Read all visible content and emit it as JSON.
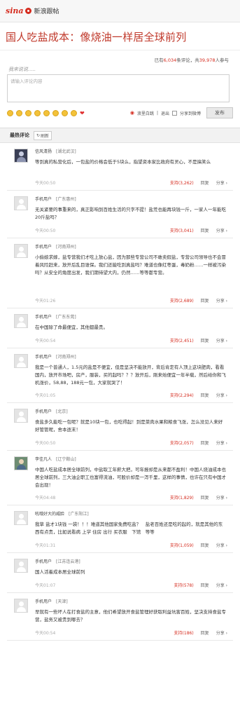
{
  "brand": {
    "logo_word": "sina",
    "product": "新浪跟帖"
  },
  "headline": "国人吃盐成本：像烧油一样居全球前列",
  "stats": {
    "prefix": "已有",
    "comments": "6,034",
    "middle": "条评论，共",
    "participants": "39,978",
    "suffix": "人参与"
  },
  "compose": {
    "heading": "我来说说.....",
    "placeholder": "请输入评论内容",
    "weibo_label": "浪里白跳",
    "logout": "退出",
    "share_label": "分享到微博",
    "submit": "发布"
  },
  "section": {
    "title": "最热评论",
    "refresh": "刷新"
  },
  "comments": [
    {
      "user": "信风清扬",
      "location": "[湖北武汉]",
      "avatar": "dark",
      "text": "等到真的私营化后，一包盐的价格会低于5块么，指望资本家比政府有灵心，不是搞笑么",
      "time": "今天00:50",
      "support": "支持(3,262)",
      "reply": "回复",
      "share": "分享 ›"
    },
    {
      "user": "手机用户",
      "location": "[广东惠州]",
      "avatar": "default",
      "text": "无关紧要的事重来的，真正影响到百姓生活的只字不提！盐荒也能再块钱一斤，一家人一年能吃20斤盐吗？",
      "time": "今天00:50",
      "support": "支持(3,041)",
      "reply": "回复",
      "share": "分享 ›"
    },
    {
      "user": "手机用户",
      "location": "[河南郑州]",
      "avatar": "default",
      "text": "小偷娘求嫁，盐专营我们才吃上放心盐，因为那些专营公司不敢卖假盐，专营公司领导也不会冒着风险赶来，放开后乱目谁保。我们还能吃到真盐吗？难道也像红枣蛋，毒奶粉……一样被污染吗？从安全的角度出发，我们期待望大内，仍然……等等都专营。",
      "time": "今天01:26",
      "support": "支持(2,689)",
      "reply": "回复",
      "share": "分享 ›"
    },
    {
      "user": "手机用户",
      "location": "[广东东莞]",
      "avatar": "default",
      "text": "在中国除了命最便宜，其他都最贵。",
      "time": "今天00:54",
      "support": "支持(2,451)",
      "reply": "回复",
      "share": "分享 ›"
    },
    {
      "user": "手机用户",
      "location": "[河南郑州]",
      "avatar": "default",
      "text": "我是一个普通人，1.5元的盐是不便宜，但是坚决不能放开，背后肯定有人顶上这块肥肉，看看国内，放开市场吧，房产，服装，买的起吗？？？放开后，刚来始便宜一年半载，然后给你和飞机涨价，58,88，188元一包，大家就哭了！",
      "time": "今天01:05",
      "support": "支持(2,294)",
      "reply": "回复",
      "share": "分享 ›"
    },
    {
      "user": "手机用户",
      "location": "[北京]",
      "avatar": "default",
      "text": "食盐多久能吃一包呢？就是10块一包，也吃得起！到是菜肉水果和粮食飞涨，怎么没见人来好好管管呢，舍本逐末！",
      "time": "今天00:50",
      "support": "支持(2,057)",
      "reply": "回复",
      "share": "分享 ›"
    },
    {
      "user": "李佳凡人",
      "location": "[辽宁鞍山]",
      "avatar": "photo",
      "text": "中国人吃盐成本居全球前列，中盐取工年薪大把，可年报却是从来都不盈利！中国人烧油成本也居全球前列，三大油企职工也富得流油，可股价却是一泻千里，这样的事情，也许在只有中国才会出现！",
      "time": "今天04:48",
      "support": "支持(1,829)",
      "reply": "回复",
      "share": "分享 ›"
    },
    {
      "user": "吼哦好大的威脸",
      "location": "[广东阳江]",
      "avatar": "default",
      "text": "我草 盐才1块钱 一袋！！！难道其他国家免费吃盐？　盐老百姓还是吃的起的，就是其他的东西有点贵，比如说看病 上学 住房 出行 买衣服　下馆　等等",
      "time": "今天01:31",
      "support": "支持(1,059)",
      "reply": "回复",
      "share": "分享 ›"
    },
    {
      "user": "手机用户",
      "location": "[江苏连云港]",
      "avatar": "default",
      "text": "国人活着成本居全球前列",
      "time": "今天01:07",
      "support": "支持(578)",
      "reply": "回复",
      "share": "分享 ›"
    },
    {
      "user": "手机用户",
      "location": "[天津]",
      "avatar": "default",
      "text": "早就有一些坏人在打食盐的主意，他们希望放开食盐管理好获取利益坑害百姓，坚决支持食盐专营，盐务又被贵到哪去？",
      "time": "今天00:54",
      "support": "支持(186)",
      "reply": "回复",
      "share": "分享 ›"
    }
  ],
  "colors": {
    "accent": "#d52b1e",
    "headline": "#c0392b"
  }
}
